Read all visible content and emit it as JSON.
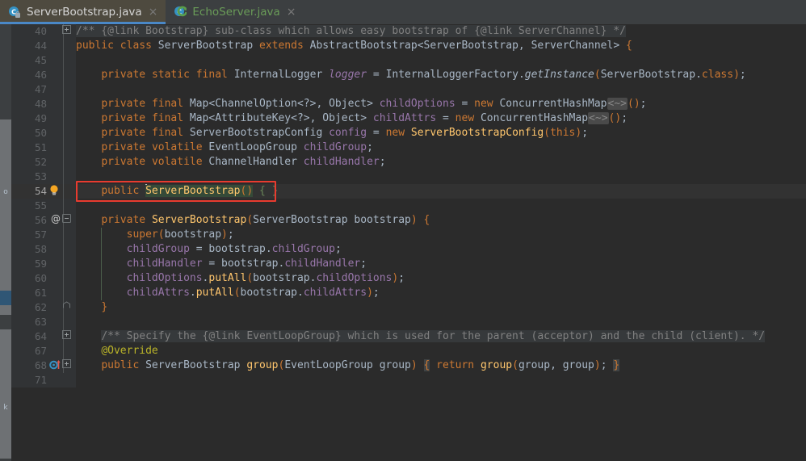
{
  "window": {
    "app": "IntelliJ IDEA Editor",
    "theme_bg": "#2b2b2b",
    "gutter_bg": "#313335",
    "accent": "#4a88c7",
    "annotation_color": "#e83b2f",
    "selection_color": "#354a38"
  },
  "tabs": [
    {
      "label": "ServerBootstrap.java",
      "icon": "java-class-final-icon",
      "active": true,
      "close_label": "×"
    },
    {
      "label": "EchoServer.java",
      "icon": "java-class-modified-icon",
      "active": false,
      "close_label": "×"
    }
  ],
  "left_stripe": {
    "labels": [
      "o",
      "k"
    ],
    "tooltip_hidden": true
  },
  "editor": {
    "current_line": "54",
    "lines": [
      {
        "num": "40",
        "fold": "plus",
        "gicon": "",
        "indent": 0,
        "text": "/** {@link Bootstrap} sub-class which allows easy bootstrap of {@link ServerChannel} */",
        "kind": "doc"
      },
      {
        "num": "44",
        "fold": "",
        "gicon": "",
        "indent": 0,
        "text": "public class ServerBootstrap extends AbstractBootstrap<ServerBootstrap, ServerChannel> {",
        "kind": "code"
      },
      {
        "num": "45",
        "fold": "",
        "gicon": "",
        "indent": 0,
        "text": "",
        "kind": "blank"
      },
      {
        "num": "46",
        "fold": "",
        "gicon": "",
        "indent": 1,
        "text": "private static final InternalLogger logger = InternalLoggerFactory.getInstance(ServerBootstrap.class);",
        "kind": "code"
      },
      {
        "num": "47",
        "fold": "",
        "gicon": "",
        "indent": 1,
        "text": "",
        "kind": "blank"
      },
      {
        "num": "48",
        "fold": "",
        "gicon": "",
        "indent": 1,
        "text": "private final Map<ChannelOption<?>, Object> childOptions = new ConcurrentHashMap<~>();",
        "kind": "code"
      },
      {
        "num": "49",
        "fold": "",
        "gicon": "",
        "indent": 1,
        "text": "private final Map<AttributeKey<?>, Object> childAttrs = new ConcurrentHashMap<~>();",
        "kind": "code"
      },
      {
        "num": "50",
        "fold": "",
        "gicon": "",
        "indent": 1,
        "text": "private final ServerBootstrapConfig config = new ServerBootstrapConfig(this);",
        "kind": "code"
      },
      {
        "num": "51",
        "fold": "",
        "gicon": "",
        "indent": 1,
        "text": "private volatile EventLoopGroup childGroup;",
        "kind": "code"
      },
      {
        "num": "52",
        "fold": "",
        "gicon": "",
        "indent": 1,
        "text": "private volatile ChannelHandler childHandler;",
        "kind": "code"
      },
      {
        "num": "53",
        "fold": "",
        "gicon": "",
        "indent": 1,
        "text": "",
        "kind": "blank"
      },
      {
        "num": "54",
        "fold": "",
        "gicon": "lightbulb-icon",
        "indent": 1,
        "text": "public ServerBootstrap() { }",
        "kind": "code",
        "current": true
      },
      {
        "num": "55",
        "fold": "",
        "gicon": "",
        "indent": 1,
        "text": "",
        "kind": "blank"
      },
      {
        "num": "56",
        "fold": "minus",
        "gicon": "at-icon",
        "indent": 1,
        "text": "private ServerBootstrap(ServerBootstrap bootstrap) {",
        "kind": "code"
      },
      {
        "num": "57",
        "fold": "",
        "gicon": "",
        "indent": 2,
        "text": "super(bootstrap);",
        "kind": "code"
      },
      {
        "num": "58",
        "fold": "",
        "gicon": "",
        "indent": 2,
        "text": "childGroup = bootstrap.childGroup;",
        "kind": "code"
      },
      {
        "num": "59",
        "fold": "",
        "gicon": "",
        "indent": 2,
        "text": "childHandler = bootstrap.childHandler;",
        "kind": "code"
      },
      {
        "num": "60",
        "fold": "",
        "gicon": "",
        "indent": 2,
        "text": "childOptions.putAll(bootstrap.childOptions);",
        "kind": "code"
      },
      {
        "num": "61",
        "fold": "",
        "gicon": "",
        "indent": 2,
        "text": "childAttrs.putAll(bootstrap.childAttrs);",
        "kind": "code"
      },
      {
        "num": "62",
        "fold": "end",
        "gicon": "",
        "indent": 1,
        "text": "}",
        "kind": "code"
      },
      {
        "num": "63",
        "fold": "",
        "gicon": "",
        "indent": 1,
        "text": "",
        "kind": "blank"
      },
      {
        "num": "64",
        "fold": "plus",
        "gicon": "",
        "indent": 1,
        "text": "/** Specify the {@link EventLoopGroup} which is used for the parent (acceptor) and the child (client). */",
        "kind": "doc"
      },
      {
        "num": "67",
        "fold": "",
        "gicon": "",
        "indent": 1,
        "text": "@Override",
        "kind": "code"
      },
      {
        "num": "68",
        "fold": "plus",
        "gicon": "override-icon",
        "indent": 1,
        "text": "public ServerBootstrap group(EventLoopGroup group) { return group(group, group); }",
        "kind": "code"
      },
      {
        "num": "71",
        "fold": "",
        "gicon": "",
        "indent": 1,
        "text": "",
        "kind": "blank"
      }
    ]
  },
  "annotation": {
    "type": "red-rectangle",
    "target_line": "54",
    "target_text": "public ServerBootstrap() { }"
  }
}
